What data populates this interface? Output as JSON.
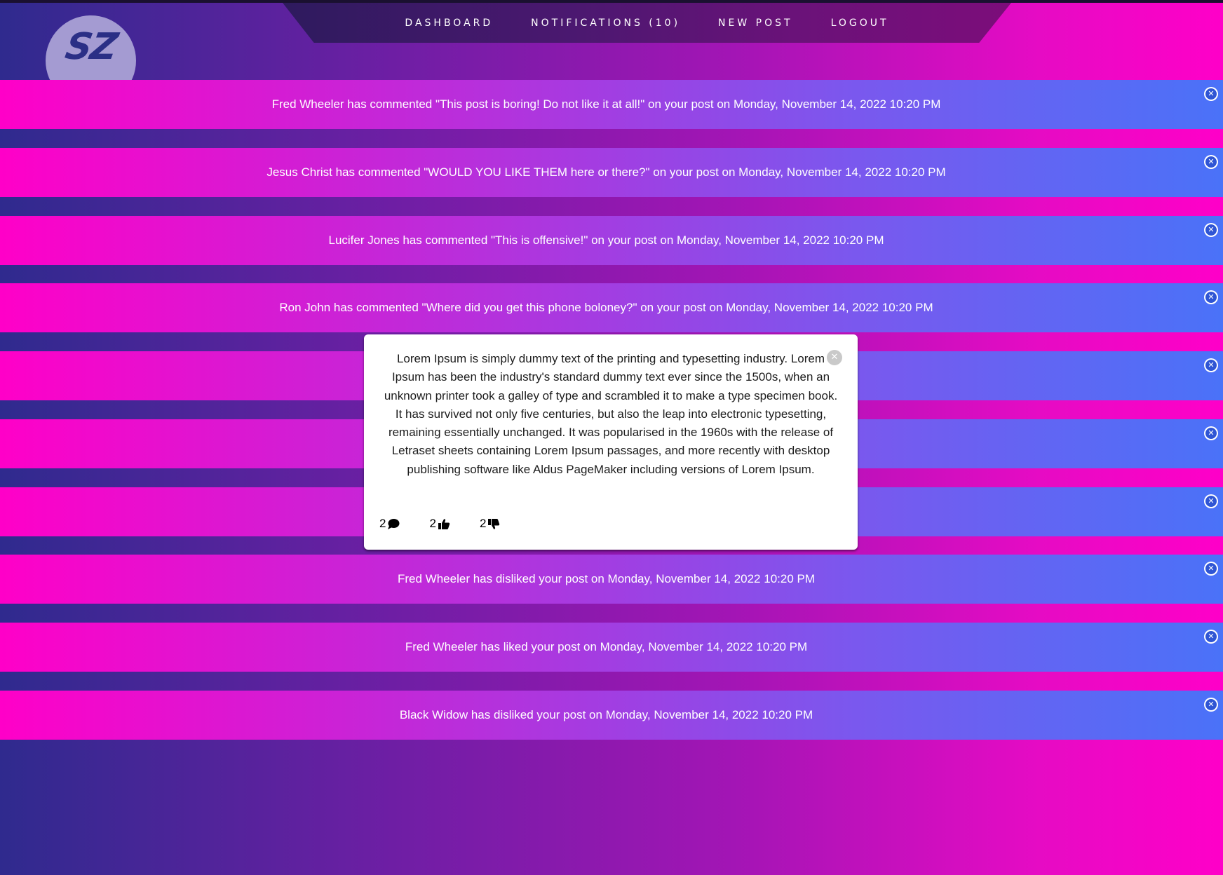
{
  "logo": {
    "text": "SZ"
  },
  "nav": {
    "items": [
      {
        "label": "DASHBOARD"
      },
      {
        "label": "NOTIFICATIONS (10)"
      },
      {
        "label": "NEW POST"
      },
      {
        "label": "LOGOUT"
      }
    ]
  },
  "notifications": [
    {
      "text": "Fred Wheeler has commented \"This post is boring! Do not like it at all!\" on your post on Monday, November 14, 2022 10:20 PM"
    },
    {
      "text": "Jesus Christ has commented \"WOULD YOU LIKE THEM here or there?\" on your post on Monday, November 14, 2022 10:20 PM"
    },
    {
      "text": "Lucifer Jones has commented \"This is offensive!\" on your post on Monday, November 14, 2022 10:20 PM"
    },
    {
      "text": "Ron John has commented \"Where did you get this phone boloney?\" on your post on Monday, November 14, 2022 10:20 PM"
    },
    {
      "text": ""
    },
    {
      "text": ""
    },
    {
      "text": ""
    },
    {
      "text": "Fred Wheeler has disliked your post on Monday, November 14, 2022 10:20 PM"
    },
    {
      "text": "Fred Wheeler has liked your post on Monday, November 14, 2022 10:20 PM"
    },
    {
      "text": "Black Widow has disliked your post on Monday, November 14, 2022 10:20 PM"
    }
  ],
  "post": {
    "body": "Lorem Ipsum is simply dummy text of the printing and typesetting industry. Lorem Ipsum has been the industry's standard dummy text ever since the 1500s, when an unknown printer took a galley of type and scrambled it to make a type specimen book. It has survived not only five centuries, but also the leap into electronic typesetting, remaining essentially unchanged. It was popularised in the 1960s with the release of Letraset sheets containing Lorem Ipsum passages, and more recently with desktop publishing software like Aldus PageMaker including versions of Lorem Ipsum.",
    "comments_count": "2",
    "likes_count": "2",
    "dislikes_count": "2"
  },
  "icons": {
    "notification_close": "close-icon",
    "post_close": "close-icon",
    "comments": "comment-icon",
    "likes": "thumbs-up-icon",
    "dislikes": "thumbs-down-icon"
  },
  "colors": {
    "background_left": "#2f2a8e",
    "background_right": "#ff00c8",
    "notification_left": "#ff00c8",
    "notification_right": "#4a72f8",
    "close_button": "#2f55d4"
  }
}
